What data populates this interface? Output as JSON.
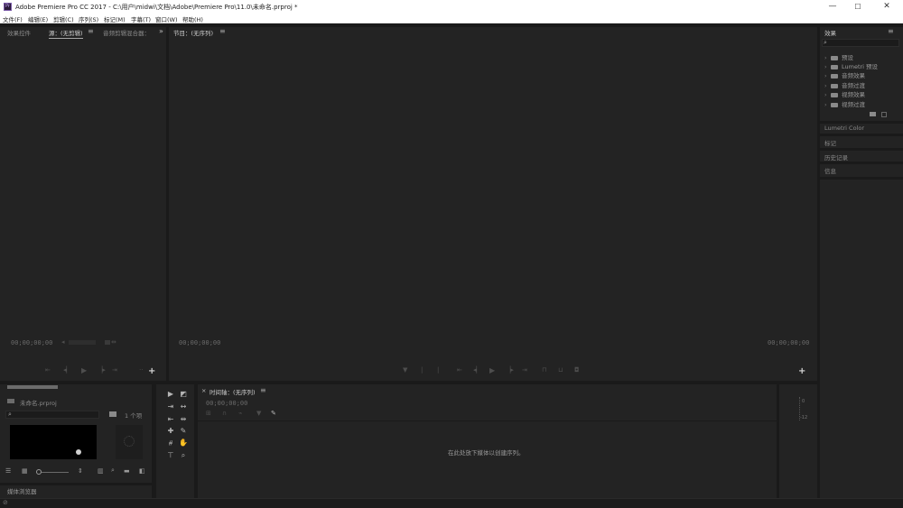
{
  "window": {
    "app_icon": "Pr",
    "title": "Adobe Premiere Pro CC 2017 - C:\\用户\\midwi\\文档\\Adobe\\Premiere Pro\\11.0\\未命名.prproj *",
    "min_glyph": "—",
    "max_glyph": "☐",
    "close_glyph": "✕"
  },
  "menu": [
    "文件(F)",
    "编辑(E)",
    "剪辑(C)",
    "序列(S)",
    "标记(M)",
    "字幕(T)",
    "窗口(W)",
    "帮助(H)"
  ],
  "source_panel": {
    "tabs": [
      "效果控件",
      "源：(无剪辑)",
      "音频剪辑混合器："
    ],
    "menu_glyph": "≡",
    "overflow_glyph": "»",
    "timecode": "00;00;00;00",
    "add_glyph": "+"
  },
  "program_panel": {
    "tab": "节目：(无序列)",
    "menu_glyph": "≡",
    "timecode_left": "00;00;00;00",
    "timecode_right": "00;00;00;00",
    "add_glyph": "+"
  },
  "effects_panel": {
    "title": "效果",
    "menu_glyph": "≡",
    "search_glyph": "⌕",
    "items": [
      "预设",
      "Lumetri 预设",
      "音频效果",
      "音频过渡",
      "视频效果",
      "视频过渡"
    ],
    "collapsed_panels": [
      "Lumetri Color",
      "标记",
      "历史记录",
      "信息"
    ]
  },
  "project_panel": {
    "project_name": "未命名.prproj",
    "item_count": "1 个项",
    "footer_label": "媒体浏览器"
  },
  "timeline_panel": {
    "close_glyph": "×",
    "tab": "时间轴：(无序列)",
    "menu_glyph": "≡",
    "timecode": "00;00;00;00",
    "empty_message": "在此处放下媒体以创建序列。"
  },
  "audio_meter": {
    "labels": [
      "0",
      "-12"
    ]
  },
  "colors": {
    "background": "#232323",
    "panel_divider": "#1a1a1a",
    "titlebar": "#ffffff"
  }
}
